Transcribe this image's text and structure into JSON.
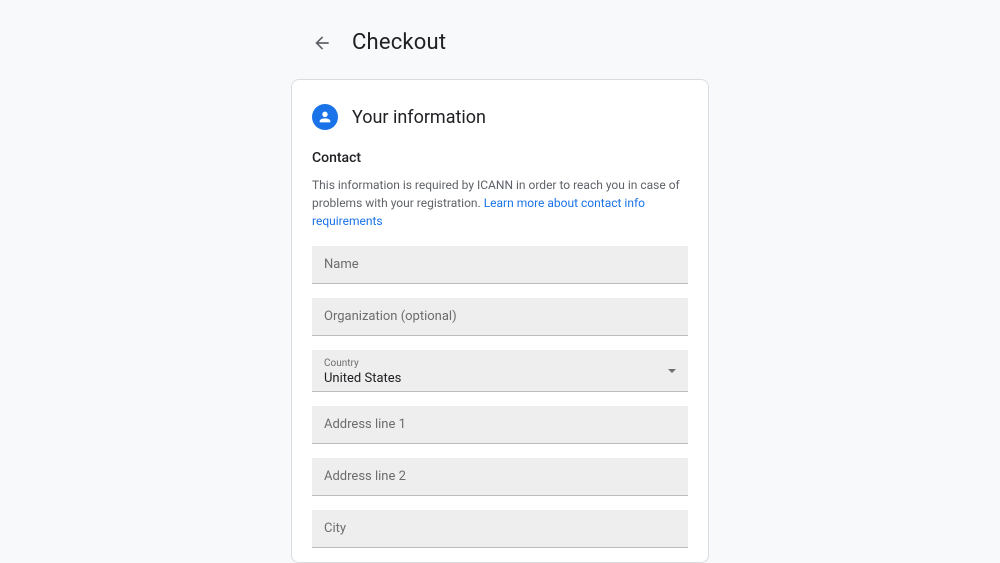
{
  "header": {
    "title": "Checkout"
  },
  "section": {
    "title": "Your information",
    "contact_heading": "Contact",
    "help_text": "This information is required by ICANN in order to reach you in case of problems with your registration. ",
    "help_link": "Learn more about contact info requirements"
  },
  "fields": {
    "name": {
      "placeholder": "Name",
      "value": ""
    },
    "organization": {
      "placeholder": "Organization (optional)",
      "value": ""
    },
    "country": {
      "label": "Country",
      "value": "United States"
    },
    "address1": {
      "placeholder": "Address line 1",
      "value": ""
    },
    "address2": {
      "placeholder": "Address line 2",
      "value": ""
    },
    "city": {
      "placeholder": "City",
      "value": ""
    }
  }
}
